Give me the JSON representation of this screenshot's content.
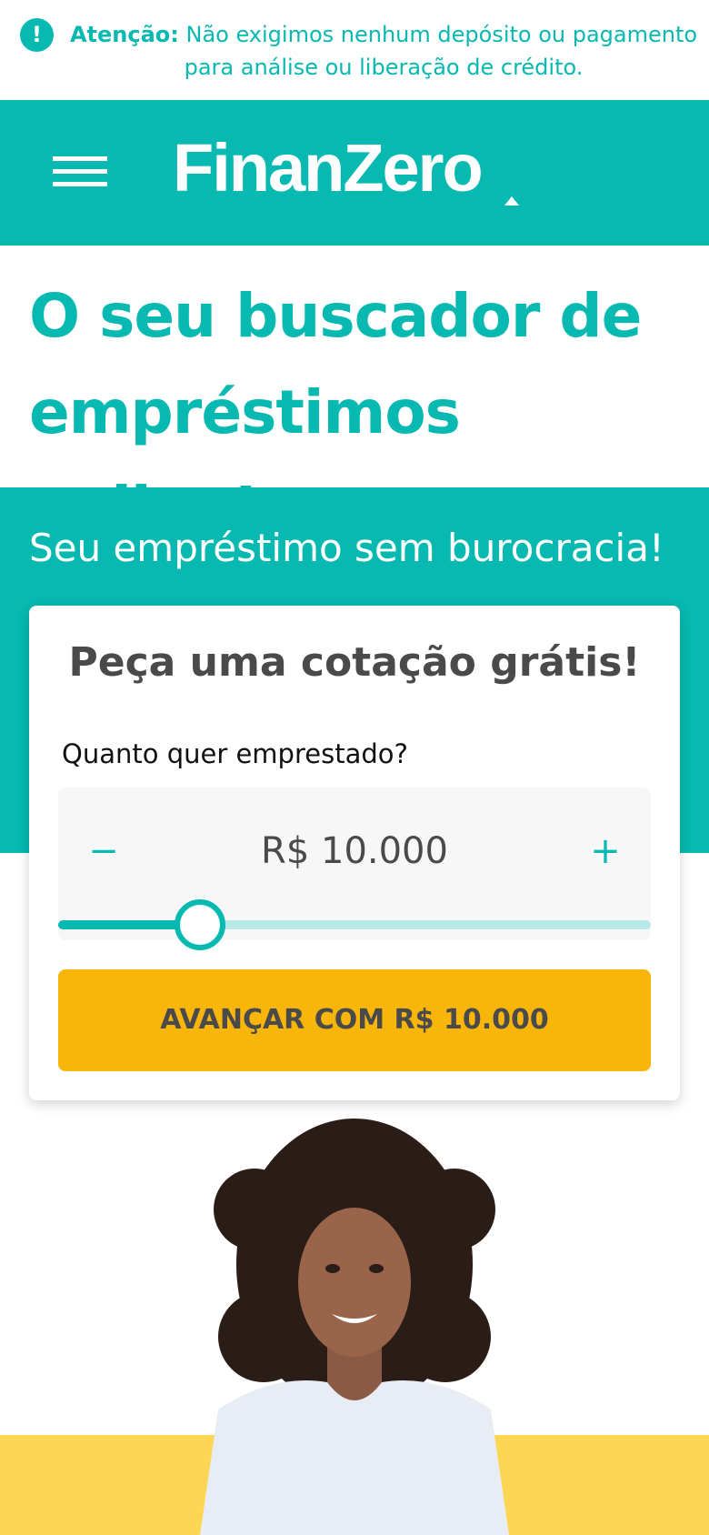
{
  "alert": {
    "icon": "exclamation-icon",
    "icon_glyph": "!",
    "prefix": "Atenção:",
    "message": " Não exigimos nenhum depósito ou pagamento para análise ou liberação de crédito."
  },
  "header": {
    "menu_icon": "hamburger-menu-icon",
    "logo_text": "FinanZero"
  },
  "hero": {
    "headline": "O seu buscador de empréstimos online!",
    "subtitle": "Seu empréstimo sem burocracia!"
  },
  "quote_card": {
    "title": "Peça uma cotação grátis!",
    "amount_label": "Quanto quer emprestado?",
    "minus_label": "−",
    "plus_label": "+",
    "amount_value": "R$ 10.000",
    "slider_fraction": 0.24,
    "cta_label": "AVANÇAR COM R$ 10.000"
  },
  "colors": {
    "brand_teal": "#07b9b0",
    "cta_yellow": "#f8b60b",
    "bottom_yellow": "#fdd654"
  },
  "hero_image": {
    "description_icon": "smiling-woman-photo"
  }
}
